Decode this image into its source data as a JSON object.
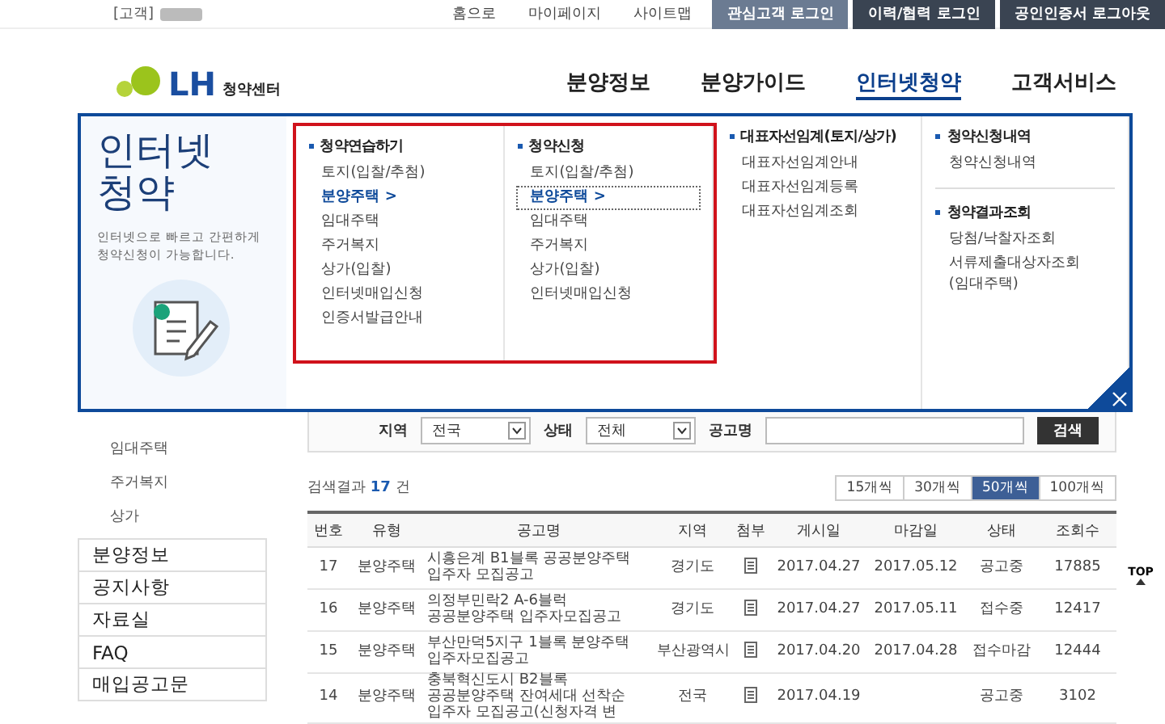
{
  "topbar": {
    "customer_label": "[고객]",
    "links": [
      "홈으로",
      "마이페이지",
      "사이트맵"
    ],
    "buttons": [
      {
        "label": "관심고객 로그인",
        "kind": "light"
      },
      {
        "label": "이력/협력 로그인",
        "kind": "dark"
      },
      {
        "label": "공인인증서 로그아웃",
        "kind": "dark"
      }
    ]
  },
  "logo": {
    "mark": "LH",
    "text": "청약센터"
  },
  "nav": [
    {
      "label": "분양정보",
      "selected": false
    },
    {
      "label": "분양가이드",
      "selected": false
    },
    {
      "label": "인터넷청약",
      "selected": true
    },
    {
      "label": "고객서비스",
      "selected": false
    }
  ],
  "mega_menu": {
    "title_lines": [
      "인터넷",
      "청약"
    ],
    "description": "인터넷으로 빠르고 간편하게 청약신청이 가능합니다.",
    "columns": [
      {
        "annotated": true,
        "groups": [
          {
            "heading": "청약연습하기",
            "items": [
              {
                "label": "토지(입찰/추첨)",
                "selected": false
              },
              {
                "label": "분양주택 >",
                "selected": true
              },
              {
                "label": "임대주택",
                "selected": false
              },
              {
                "label": "주거복지",
                "selected": false
              },
              {
                "label": "상가(입찰)",
                "selected": false
              },
              {
                "label": "인터넷매입신청",
                "selected": false
              },
              {
                "label": "인증서발급안내",
                "selected": false
              }
            ]
          }
        ]
      },
      {
        "annotated": true,
        "groups": [
          {
            "heading": "청약신청",
            "items": [
              {
                "label": "토지(입찰/추첨)",
                "selected": false
              },
              {
                "label": "분양주택 >",
                "selected": true
              },
              {
                "label": "임대주택",
                "selected": false
              },
              {
                "label": "주거복지",
                "selected": false
              },
              {
                "label": "상가(입찰)",
                "selected": false
              },
              {
                "label": "인터넷매입신청",
                "selected": false
              }
            ]
          }
        ]
      },
      {
        "annotated": false,
        "groups": [
          {
            "heading": "대표자선임계(토지/상가)",
            "items": [
              {
                "label": "대표자선임계안내",
                "selected": false
              },
              {
                "label": "대표자선임계등록",
                "selected": false
              },
              {
                "label": "대표자선임계조회",
                "selected": false
              }
            ]
          }
        ]
      },
      {
        "annotated": false,
        "groups": [
          {
            "heading": "청약신청내역",
            "items": [
              {
                "label": "청약신청내역",
                "selected": false
              }
            ]
          },
          {
            "heading": "청약결과조회",
            "items": [
              {
                "label": "당첨/낙찰자조회",
                "selected": false
              },
              {
                "label": "서류제출대상자조회 (임대주택)",
                "selected": false
              }
            ]
          }
        ]
      }
    ]
  },
  "sidebar": {
    "sub_items": [
      "임대주택",
      "주거복지",
      "상가"
    ],
    "items": [
      "분양정보",
      "공지사항",
      "자료실",
      "FAQ",
      "매입공고문"
    ]
  },
  "search": {
    "fields": [
      {
        "label": "지역",
        "kind": "select",
        "value": "전국"
      },
      {
        "label": "상태",
        "kind": "select",
        "value": "전체"
      },
      {
        "label": "공고명",
        "kind": "text"
      }
    ],
    "button": "검색"
  },
  "results": {
    "summary": "검색결과 **17** 건",
    "page_sizes": [
      {
        "label": "15개씩",
        "selected": false
      },
      {
        "label": "30개씩",
        "selected": false
      },
      {
        "label": "50개씩",
        "selected": true
      },
      {
        "label": "100개씩",
        "selected": false
      }
    ]
  },
  "table": {
    "columns": [
      "번호",
      "유형",
      "공고명",
      "지역",
      "첨부",
      "게시일",
      "마감일",
      "상태",
      "조회수"
    ],
    "rows": [
      {
        "no": "17",
        "type": "분양주택",
        "title": "시흥은계 B1블록 공공분양주택 입주자 모집공고",
        "region": "경기도",
        "attachment": true,
        "posted": "2017.04.27",
        "deadline": "2017.05.12",
        "status": "공고중",
        "views": "17885"
      },
      {
        "no": "16",
        "type": "분양주택",
        "title": "의정부민락2 A-6블럭 공공분양주택 입주자모집공고",
        "region": "경기도",
        "attachment": true,
        "posted": "2017.04.27",
        "deadline": "2017.05.11",
        "status": "접수중",
        "views": "12417"
      },
      {
        "no": "15",
        "type": "분양주택",
        "title": "부산만덕5지구 1블록 분양주택 입주자모집공고",
        "region": "부산광역시",
        "attachment": true,
        "posted": "2017.04.20",
        "deadline": "2017.04.28",
        "status": "접수마감",
        "views": "12444"
      },
      {
        "no": "14",
        "type": "분양주택",
        "title": "충북혁신도시 B2블록 공공분양주택 잔여세대 선착순 입주자 모집공고(신청자격 변",
        "region": "전국",
        "attachment": true,
        "posted": "2017.04.19",
        "status": "공고중",
        "views": "3102"
      }
    ]
  },
  "top_button": "TOP"
}
